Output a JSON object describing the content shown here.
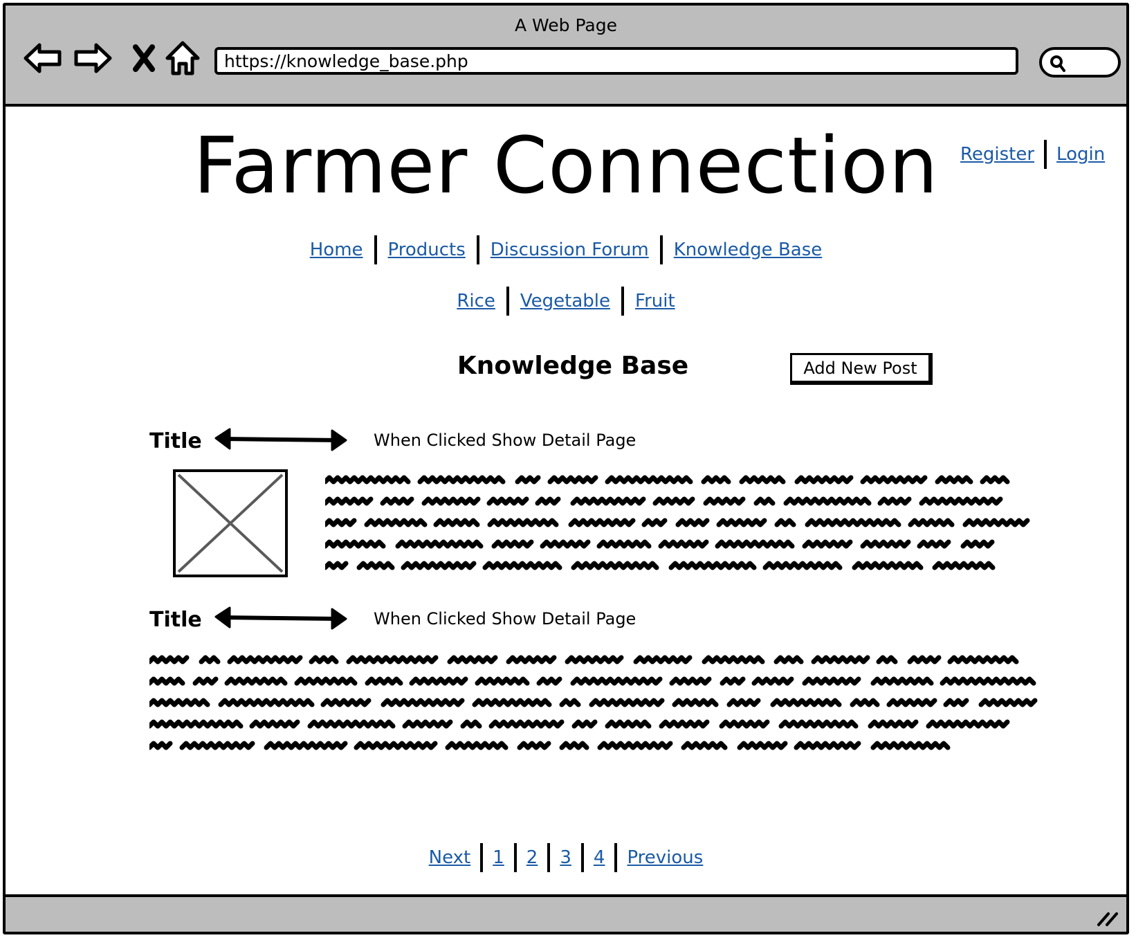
{
  "browser": {
    "title": "A Web Page",
    "url": "https://knowledge_base.php",
    "icons": [
      "back-arrow-icon",
      "forward-arrow-icon",
      "close-x-icon",
      "home-icon",
      "search-icon",
      "resize-grip-icon"
    ]
  },
  "header": {
    "site_title": "Farmer Connection",
    "auth_links": [
      "Register",
      "Login"
    ]
  },
  "main_nav": [
    "Home",
    "Products",
    "Discussion Forum",
    "Knowledge Base"
  ],
  "sub_nav": [
    "Rice",
    "Vegetable",
    "Fruit"
  ],
  "content": {
    "heading": "Knowledge Base",
    "add_post_label": "Add New Post",
    "posts": [
      {
        "title": "Title",
        "note": "When Clicked Show Detail Page"
      },
      {
        "title": "Title",
        "note": "When Clicked Show Detail Page"
      }
    ]
  },
  "pagination": [
    "Next",
    "1",
    "2",
    "3",
    "4",
    "Previous"
  ],
  "colors": {
    "chrome": "#bdbdbd",
    "link": "#1a5aa6",
    "ink": "#000000",
    "placeholder_cross": "#5a5a5a"
  }
}
